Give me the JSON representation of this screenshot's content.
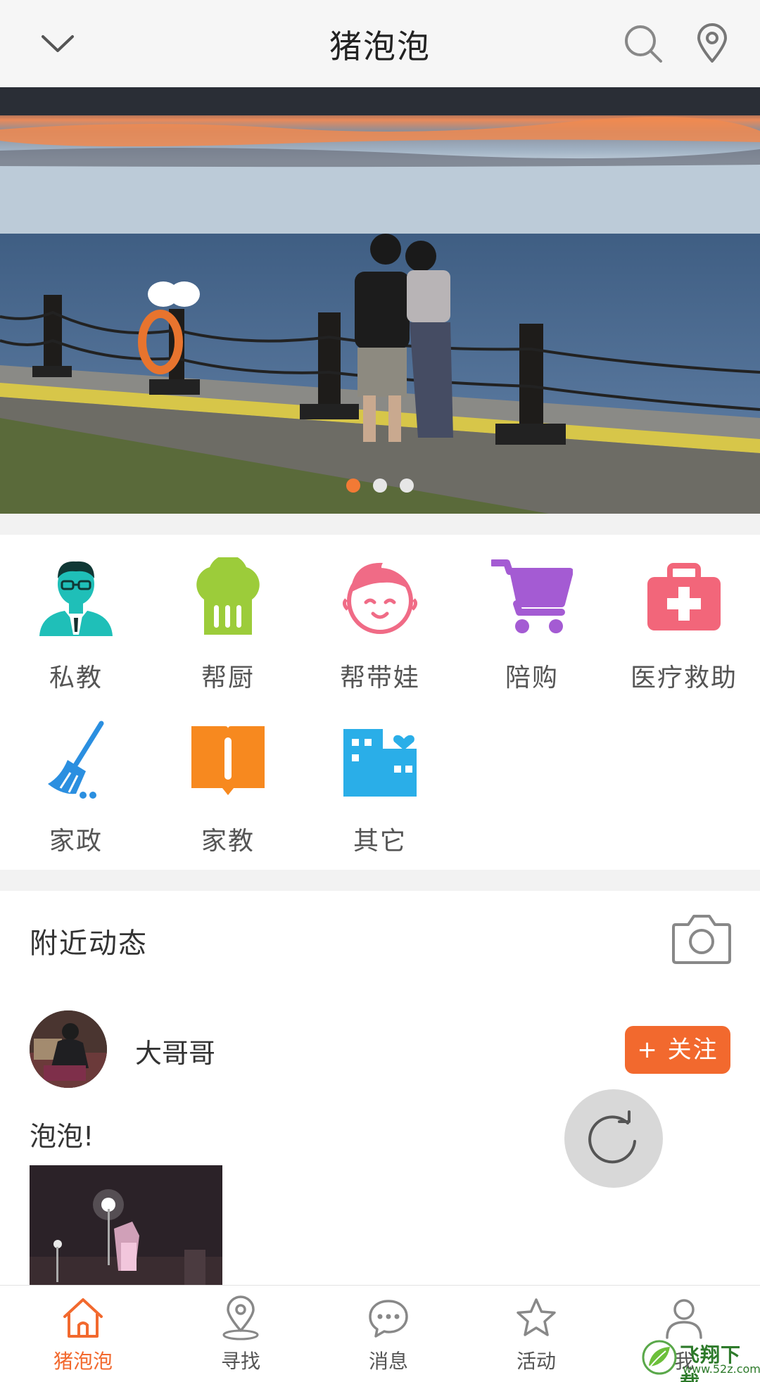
{
  "header": {
    "title": "猪泡泡",
    "back_icon": "chevron-down-icon",
    "search_icon": "search-icon",
    "location_icon": "location-pin-icon"
  },
  "banner": {
    "slide_count": 3,
    "active_slide": 1,
    "accent_color": "#f27a35"
  },
  "categories": [
    {
      "label": "私教",
      "icon": "personal-trainer-icon",
      "color": "#1fbfb8"
    },
    {
      "label": "帮厨",
      "icon": "chef-hat-icon",
      "color": "#9ccc3a"
    },
    {
      "label": "帮带娃",
      "icon": "baby-face-icon",
      "color": "#f06b86"
    },
    {
      "label": "陪购",
      "icon": "shopping-cart-icon",
      "color": "#a45bd3"
    },
    {
      "label": "医疗救助",
      "icon": "first-aid-kit-icon",
      "color": "#f2667a"
    },
    {
      "label": "家政",
      "icon": "broom-icon",
      "color": "#2b8fe0"
    },
    {
      "label": "家教",
      "icon": "book-icon",
      "color": "#f7891f"
    },
    {
      "label": "其它",
      "icon": "building-heart-icon",
      "color": "#2aaee8"
    }
  ],
  "feed": {
    "section_title": "附近动态",
    "camera_icon": "camera-icon",
    "post": {
      "username": "大哥哥",
      "follow_label": "+ 关注",
      "text": "泡泡!"
    }
  },
  "tabs": [
    {
      "label": "猪泡泡",
      "icon": "home-icon",
      "active": true
    },
    {
      "label": "寻找",
      "icon": "location-pin-icon",
      "active": false
    },
    {
      "label": "消息",
      "icon": "chat-bubble-icon",
      "active": false
    },
    {
      "label": "活动",
      "icon": "star-icon",
      "active": false
    },
    {
      "label": "我",
      "icon": "user-icon",
      "active": false
    }
  ],
  "watermark": {
    "text": "飞翔下载",
    "sub": "www.52z.com"
  },
  "colors": {
    "accent": "#f2692e"
  }
}
